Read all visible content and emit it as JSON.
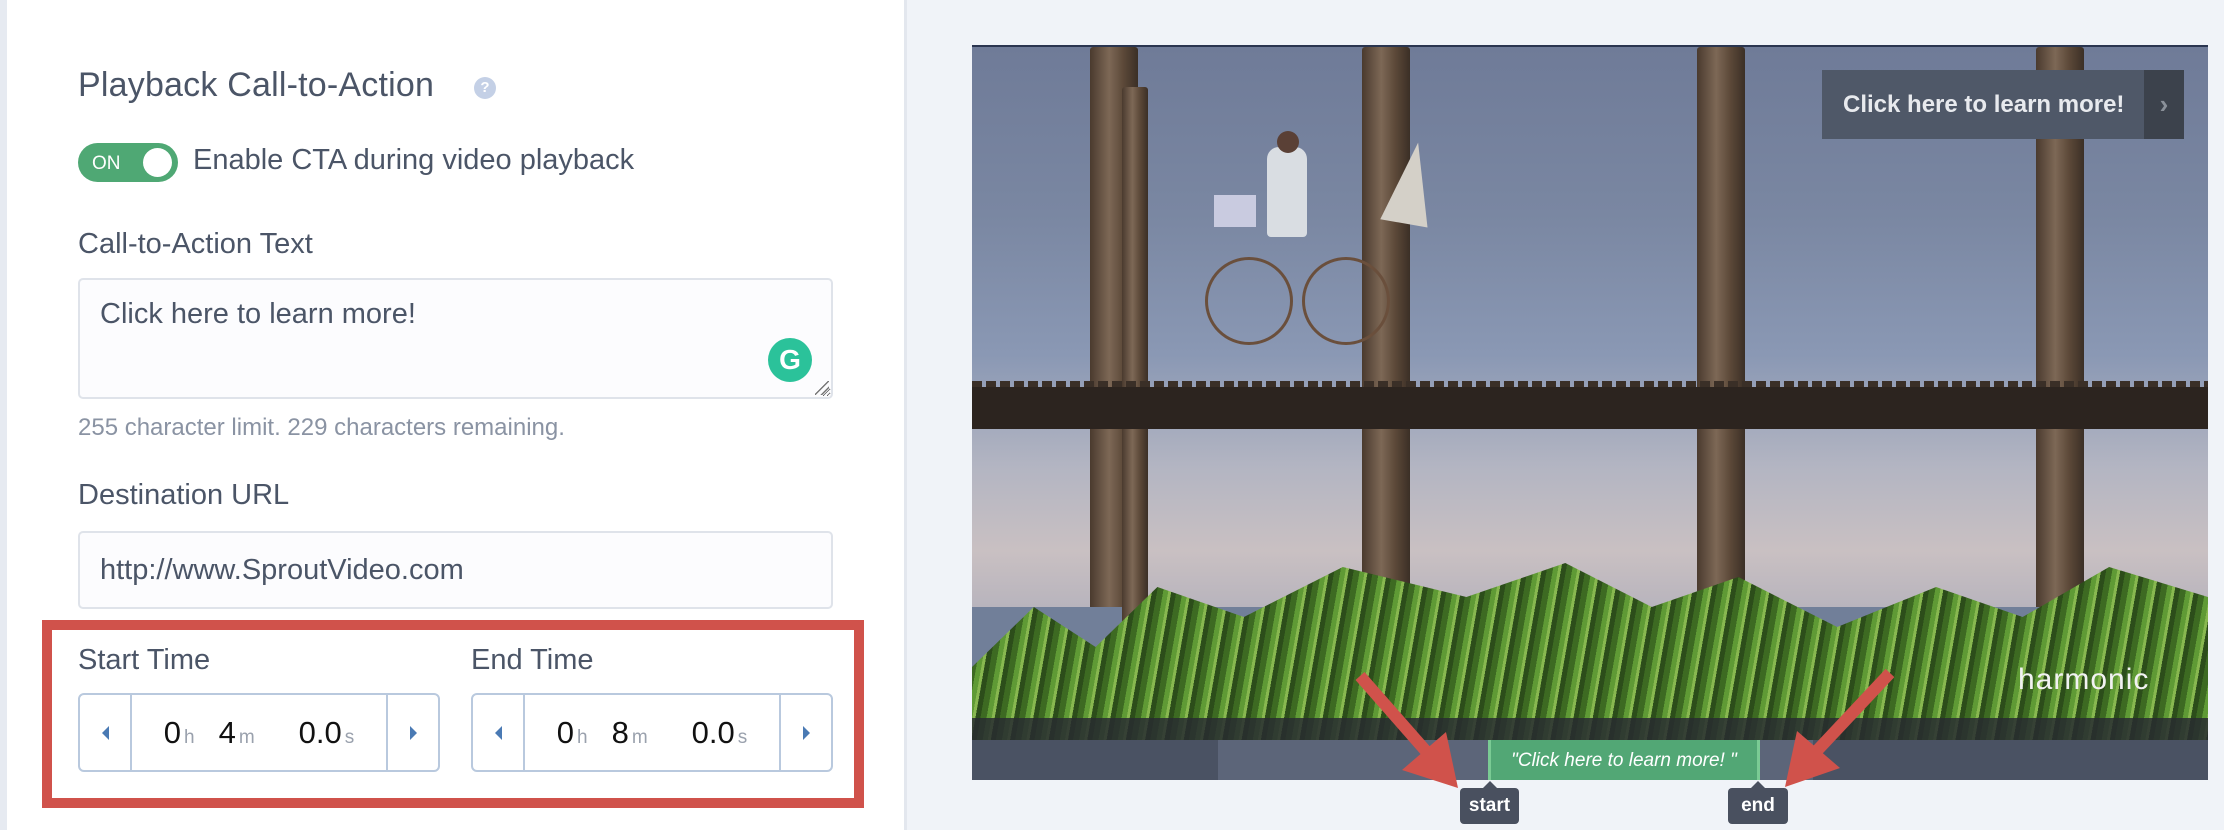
{
  "settings": {
    "title": "Playback Call-to-Action",
    "help_icon": "question-circle-icon",
    "toggle": {
      "state_label": "ON",
      "enabled": true,
      "description": "Enable CTA during video playback"
    },
    "cta_text": {
      "label": "Call-to-Action Text",
      "value": "Click here to learn more!",
      "helper": "255 character limit. 229 characters remaining.",
      "grammarly_icon": "G"
    },
    "destination_url": {
      "label": "Destination URL",
      "value": "http://www.SproutVideo.com"
    },
    "start_time": {
      "label": "Start Time",
      "hours": "0",
      "hours_unit": "h",
      "minutes": "4",
      "minutes_unit": "m",
      "seconds": "0.0",
      "seconds_unit": "s"
    },
    "end_time": {
      "label": "End Time",
      "hours": "0",
      "hours_unit": "h",
      "minutes": "8",
      "minutes_unit": "m",
      "seconds": "0.0",
      "seconds_unit": "s"
    }
  },
  "preview": {
    "cta_overlay_text": "Click here to learn more!",
    "cta_overlay_arrow": "›",
    "watermark": "harmonic",
    "timeline_cta_label": "\"Click here to learn more! \"",
    "start_marker": "start",
    "end_marker": "end"
  },
  "colors": {
    "accent_green": "#52a775",
    "highlight_red": "#d0524b",
    "stepper_blue": "#4a7ab4"
  }
}
